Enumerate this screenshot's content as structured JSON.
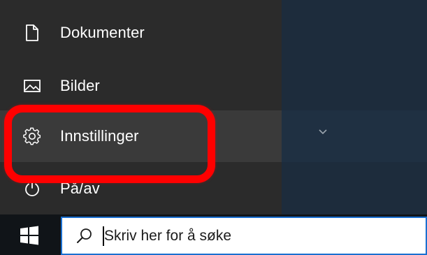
{
  "start_menu": {
    "items": [
      {
        "label": "Dokumenter",
        "icon": "document-icon"
      },
      {
        "label": "Bilder",
        "icon": "picture-icon"
      },
      {
        "label": "Innstillinger",
        "icon": "gear-icon"
      },
      {
        "label": "På/av",
        "icon": "power-icon"
      }
    ]
  },
  "taskbar": {
    "search": {
      "placeholder": "Skriv her for å søke"
    }
  },
  "colors": {
    "highlight": "#ff0000",
    "search_border": "#1a6fd0",
    "menu_bg": "#2b2b2b",
    "menu_hover": "#3a3a3a"
  }
}
